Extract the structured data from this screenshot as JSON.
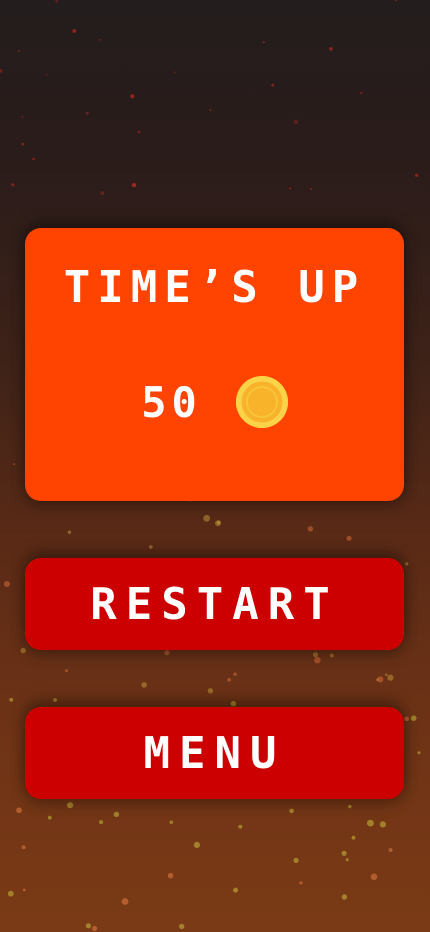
{
  "result": {
    "title": "TIME’S UP",
    "score": "50"
  },
  "icons": {
    "coin": "coin-icon"
  },
  "buttons": {
    "restart_label": "RESTART",
    "menu_label": "MENU"
  },
  "colors": {
    "result_card": "#ff4300",
    "button": "#cc0000",
    "coin": "#f9b32a",
    "text": "#ffffff"
  }
}
